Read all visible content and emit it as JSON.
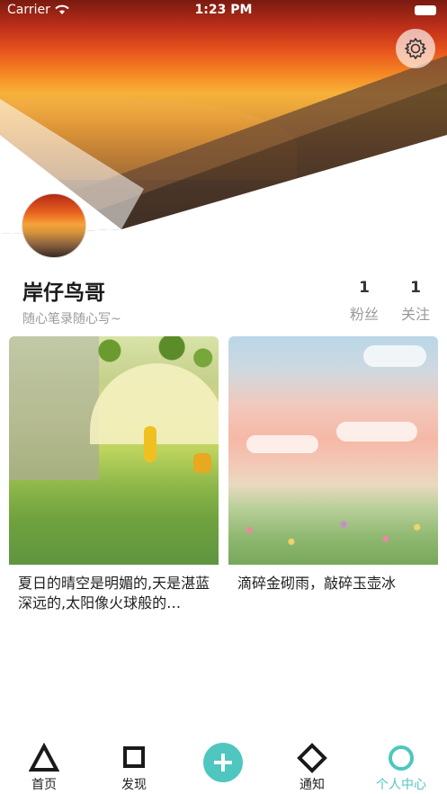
{
  "status_bar": {
    "carrier": "Carrier",
    "time": "1:23 PM"
  },
  "profile": {
    "username": "岸仔鸟哥",
    "signature": "随心笔录随心写~",
    "fans_count": "1",
    "fans_label": "粉丝",
    "follow_count": "1",
    "follow_label": "关注"
  },
  "posts": [
    {
      "title": "夏日的晴空是明媚的,天是湛蓝深远的,太阳像火球般的…"
    },
    {
      "title": "滴碎金砌雨，敲碎玉壶冰"
    }
  ],
  "tabs": [
    {
      "label": "首页",
      "icon": "triangle-icon"
    },
    {
      "label": "发现",
      "icon": "square-icon"
    },
    {
      "label": "",
      "icon": "plus-icon"
    },
    {
      "label": "通知",
      "icon": "diamond-icon"
    },
    {
      "label": "个人中心",
      "icon": "circle-icon"
    }
  ],
  "colors": {
    "accent": "#4fc6bf",
    "text_primary": "#1a1a1a",
    "text_secondary": "#9a9a9a"
  }
}
